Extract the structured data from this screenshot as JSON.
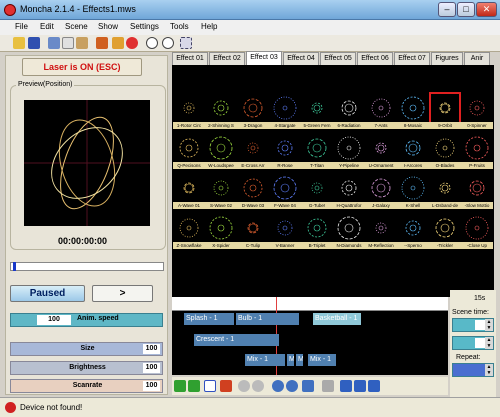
{
  "window": {
    "title": "Moncha 2.1.4 - Effects1.mws"
  },
  "menu": [
    "File",
    "Edit",
    "Scene",
    "Show",
    "Settings",
    "Tools",
    "Help"
  ],
  "laser_button": "Laser is ON (ESC)",
  "preview": {
    "label": "Preview(Position)",
    "timecode": "00:00:00:00"
  },
  "playback": {
    "paused_label": "Paused",
    "play_label": ">"
  },
  "sliders": {
    "anim_speed": {
      "label": "Anim. speed",
      "value": "100"
    },
    "size": {
      "label": "Size",
      "value": "100"
    },
    "brightness": {
      "label": "Brightness",
      "value": "100"
    },
    "scanrate": {
      "label": "Scanrate",
      "value": "100"
    }
  },
  "tabs": [
    "Effect 01",
    "Effect 02",
    "Effect 03",
    "Effect 04",
    "Effect 05",
    "Effect 06",
    "Effect 07",
    "Figures",
    "Anir"
  ],
  "active_tab": 2,
  "effects": [
    "1-Rotor Circ",
    "2-Shinning S",
    "3-Dragon",
    "4-Stargate",
    "5-Green Fern",
    "6-Radiation",
    "7-Ants",
    "8-Mosaic",
    "9-Orbit",
    "0-Spinner",
    "Q-Pecisons",
    "W-Loudspee",
    "E-Cross Arr",
    "R-Rose",
    "T-Titan",
    "Y-Pipeline",
    "U-Ornament",
    "I-Arcores",
    "O-Blades",
    "P-Fruits",
    "A-Wave 01",
    "S-Wave 02",
    "D-Wave 03",
    "F-Wave 04",
    "G-Tube!",
    "H-Quattrofor",
    "J-Galaxy",
    "K-Shell",
    "L-Dsband-de",
    "-Slow Mottio",
    "Z-Snowflake",
    "X-Spider",
    "C-Tulip",
    "V-Banner",
    "B-Triplet",
    "N-Diamonds",
    "M-Reflection",
    "--Sperno",
    "-Trickler",
    "-Close Up"
  ],
  "selected_effect": 8,
  "timeline": {
    "clips": [
      "Splash - 1",
      "Bulb - 1",
      "Basketball - 1",
      "Crescent - 1",
      "Mix - 1",
      "M",
      "M",
      "Mix - 1"
    ]
  },
  "right_panel": {
    "seconds": "15s",
    "scene_time_label": "Scene time:",
    "repeat_label": "Repeat:"
  },
  "status": {
    "text": "Device not found!"
  },
  "colors": {
    "accent": "#5fb7c6",
    "laser_red": "#d01010",
    "caption_bg": "#e6d9a4"
  }
}
